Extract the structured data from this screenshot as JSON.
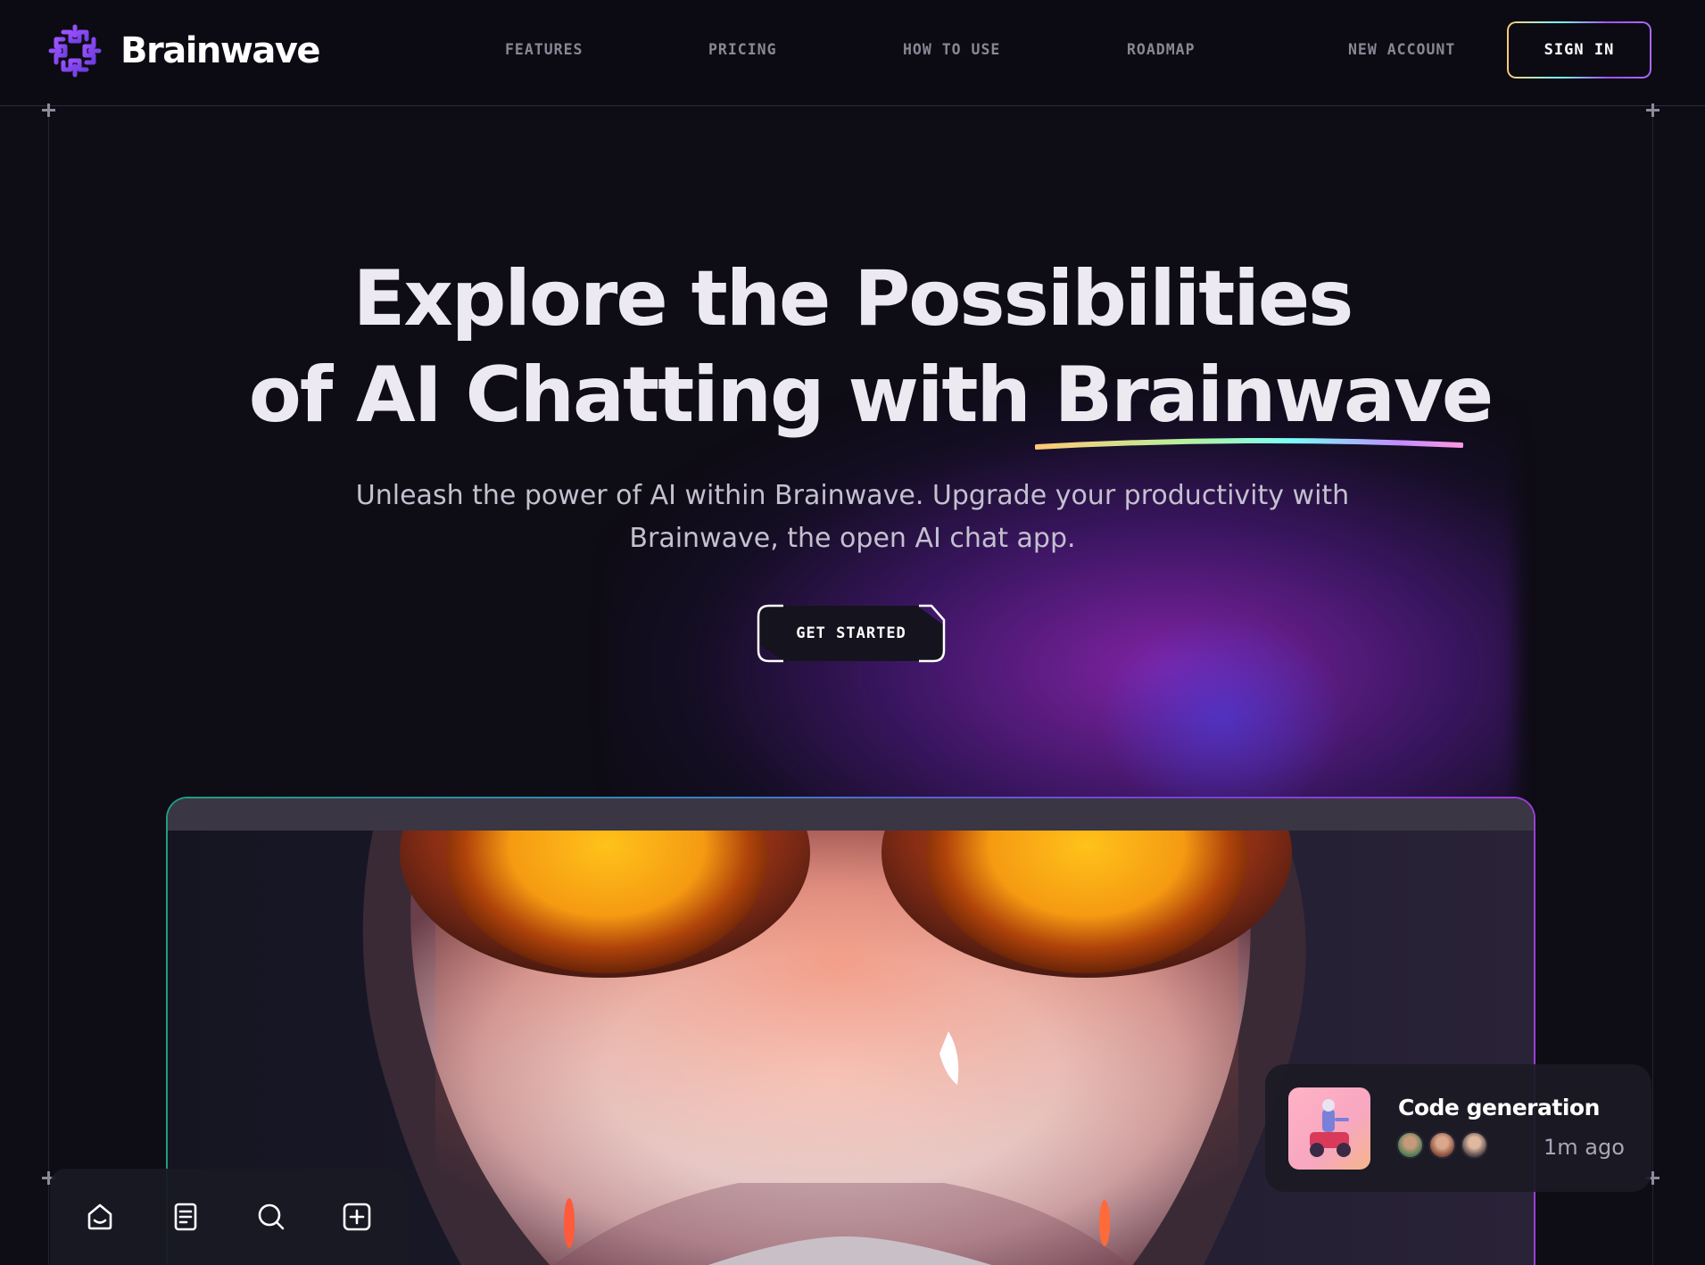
{
  "brand": {
    "name": "Brainwave"
  },
  "nav": {
    "items": [
      {
        "label": "FEATURES"
      },
      {
        "label": "PRICING"
      },
      {
        "label": "HOW TO USE"
      },
      {
        "label": "ROADMAP"
      }
    ],
    "new_account": "NEW ACCOUNT",
    "sign_in": "SIGN IN"
  },
  "hero": {
    "title_line1": "Explore the Possibilities",
    "title_line2": "of AI Chatting with Brainwave",
    "subtitle_line1": "Unleash the power of AI within Brainwave. Upgrade your productivity with",
    "subtitle_line2": "Brainwave, the open AI chat app.",
    "cta": "GET STARTED"
  },
  "notification": {
    "title": "Code generation",
    "time": "1m ago"
  },
  "toolbar": {
    "icons": [
      "home-icon",
      "document-icon",
      "search-icon",
      "add-square-icon"
    ]
  },
  "colors": {
    "background": "#0e0c15",
    "accent_purple": "#ac6aff",
    "accent_cyan": "#79fff7",
    "accent_yellow": "#ffc876"
  }
}
